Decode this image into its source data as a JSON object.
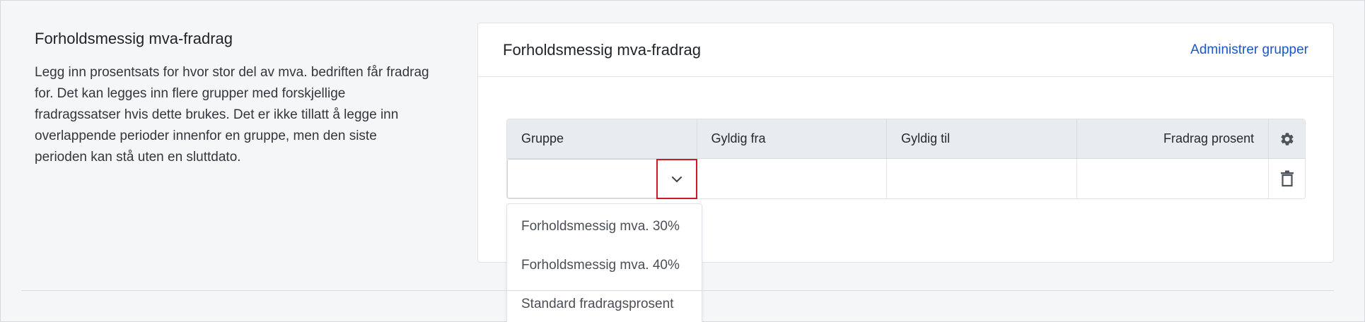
{
  "section": {
    "title": "Forholdsmessig mva-fradrag",
    "description": "Legg inn prosentsats for hvor stor del av mva. bedriften får fradrag for. Det kan legges inn flere grupper med forskjellige fradragssatser hvis dette brukes. Det er ikke tillatt å legge inn overlappende perioder innenfor en gruppe, men den siste perioden kan stå uten en sluttdato."
  },
  "card": {
    "title": "Forholdsmessig mva-fradrag",
    "manage_link": "Administrer grupper"
  },
  "table": {
    "columns": [
      "Gruppe",
      "Gyldig fra",
      "Gyldig til",
      "Fradrag prosent"
    ],
    "settings_icon": "gear-icon",
    "rows": [
      {
        "gruppe": "",
        "gyldig_fra": "",
        "gyldig_til": "",
        "fradrag_prosent": "",
        "delete_icon": "trash-icon"
      }
    ]
  },
  "dropdown": {
    "options": [
      "Forholdsmessig mva. 30%",
      "Forholdsmessig mva. 40%",
      "Standard fradragsprosent"
    ]
  },
  "colors": {
    "accent_link": "#1a56c4",
    "highlight_border": "#d0191f",
    "header_bg": "#e8ecf0"
  }
}
